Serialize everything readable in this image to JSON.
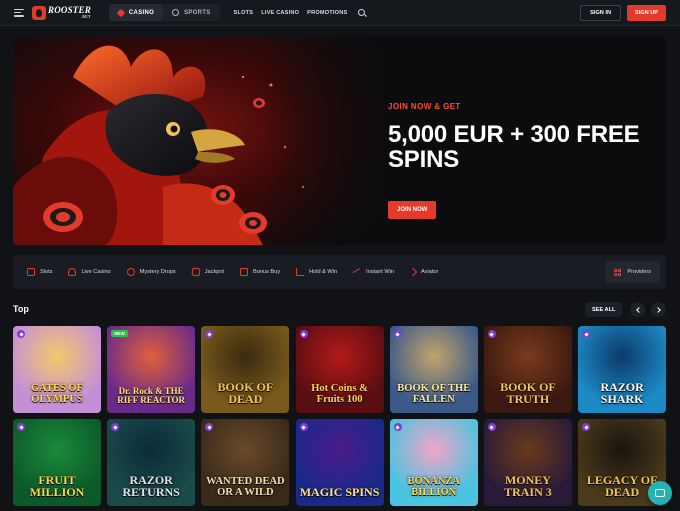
{
  "header": {
    "logo_text": "ROOSTER",
    "logo_sub": ".BET",
    "modes": [
      {
        "label": "CASINO",
        "active": true
      },
      {
        "label": "SPORTS",
        "active": false
      }
    ],
    "nav": [
      "SLOTS",
      "LIVE CASINO",
      "PROMOTIONS"
    ],
    "sign_in": "SIGN IN",
    "sign_up": "SIGN UP"
  },
  "hero": {
    "kicker": "JOIN NOW & GET",
    "title": "5,000 EUR + 300 FREE SPINS",
    "cta": "JOIN NOW",
    "slides": 3,
    "active_slide": 1
  },
  "categories": [
    {
      "label": "Slots",
      "icon": "slots-icon"
    },
    {
      "label": "Live Casino",
      "icon": "live-casino-icon"
    },
    {
      "label": "Mystery Drops",
      "icon": "mystery-drops-icon"
    },
    {
      "label": "Jackpot",
      "icon": "jackpot-icon"
    },
    {
      "label": "Bonus Buy",
      "icon": "bonus-buy-icon"
    },
    {
      "label": "Hold & Win",
      "icon": "hold-win-icon"
    },
    {
      "label": "Instant Win",
      "icon": "instant-win-icon"
    },
    {
      "label": "Aviator",
      "icon": "aviator-icon"
    }
  ],
  "providers_label": "Providers",
  "top_section": {
    "title": "Top",
    "see_all": "SEE ALL"
  },
  "games": [
    {
      "name": "GATES OF OLYMPUS",
      "badge": "star",
      "bg": "#c58fd6",
      "bg2": "#f3c86b",
      "fg": "#ffd54a"
    },
    {
      "name": "Dr. Rock & THE RIFF REACTOR",
      "badge": "NEW",
      "bg": "#6a2a8a",
      "bg2": "#e0603a",
      "fg": "#ffe27a"
    },
    {
      "name": "BOOK OF DEAD",
      "badge": "star",
      "bg": "#7a5a1c",
      "bg2": "#3a2a10",
      "fg": "#f3c45a"
    },
    {
      "name": "Hot Coins & Fruits 100",
      "badge": "star",
      "bg": "#5a0e12",
      "bg2": "#b31a1a",
      "fg": "#ffd54a"
    },
    {
      "name": "BOOK OF THE FALLEN",
      "badge": "star",
      "bg": "#3a5a8a",
      "bg2": "#c4a36a",
      "fg": "#f7e9a6"
    },
    {
      "name": "BOOK OF TRUTH",
      "badge": "star",
      "bg": "#3a1a10",
      "bg2": "#7a3a1c",
      "fg": "#f3c45a"
    },
    {
      "name": "RAZOR SHARK",
      "badge": "star",
      "bg": "#1c8ac4",
      "bg2": "#0c3a6a",
      "fg": "#ffffff"
    },
    {
      "name": "FRUIT MILLION",
      "badge": "star",
      "bg": "#0c5a2a",
      "bg2": "#1a8a3a",
      "fg": "#ffd54a"
    },
    {
      "name": "RAZOR RETURNS",
      "badge": "star",
      "bg": "#1a4a4a",
      "bg2": "#0c2a3a",
      "fg": "#dfe6ea"
    },
    {
      "name": "WANTED DEAD OR A WILD",
      "badge": "star",
      "bg": "#3a2a1a",
      "bg2": "#6a4a2a",
      "fg": "#f1e0b0"
    },
    {
      "name": "MAGIC SPINS",
      "badge": "star",
      "bg": "#1a2a8a",
      "bg2": "#4a1a8a",
      "fg": "#ffe27a"
    },
    {
      "name": "BONANZA BILLION",
      "badge": "star",
      "bg": "#4ac4e0",
      "bg2": "#f3a4c8",
      "fg": "#ffd54a"
    },
    {
      "name": "MONEY TRAIN 3",
      "badge": "star",
      "bg": "#2a1a3a",
      "bg2": "#6a3a1a",
      "fg": "#f3c45a"
    },
    {
      "name": "LEGACY OF DEAD",
      "badge": "star",
      "bg": "#4a3a1a",
      "bg2": "#1a1410",
      "fg": "#f3c45a"
    }
  ],
  "colors": {
    "accent": "#e43a2c",
    "background": "#101216",
    "surface": "#191c22",
    "chat": "#24b3b5"
  }
}
